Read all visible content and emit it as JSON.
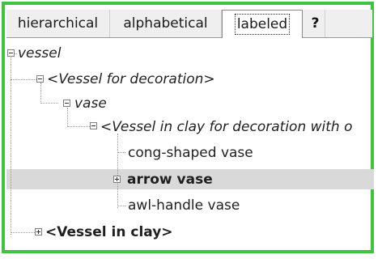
{
  "tabs": [
    {
      "label": "hierarchical",
      "active": false
    },
    {
      "label": "alphabetical",
      "active": false
    },
    {
      "label": "labeled",
      "active": true
    },
    {
      "label": "?",
      "active": false
    }
  ],
  "tree": {
    "root": {
      "label": "vessel",
      "expanded": true
    },
    "decoration_group": {
      "label": "<Vessel for decoration>",
      "expanded": true
    },
    "vase": {
      "label": "vase",
      "expanded": true
    },
    "clay_decoration_group": {
      "label": "<Vessel in clay for decoration with o",
      "expanded": true
    },
    "cong_vase": {
      "label": "cong-shaped vase"
    },
    "arrow_vase": {
      "label": "arrow vase",
      "expanded": false,
      "selected": true
    },
    "awl_vase": {
      "label": "awl-handle vase"
    },
    "clay_group": {
      "label": "<Vessel in clay>",
      "expanded": false
    }
  },
  "colors": {
    "frame_border": "#3ec43e",
    "selection": "#d9d9d9",
    "help_highlight": "#f6f37a"
  }
}
